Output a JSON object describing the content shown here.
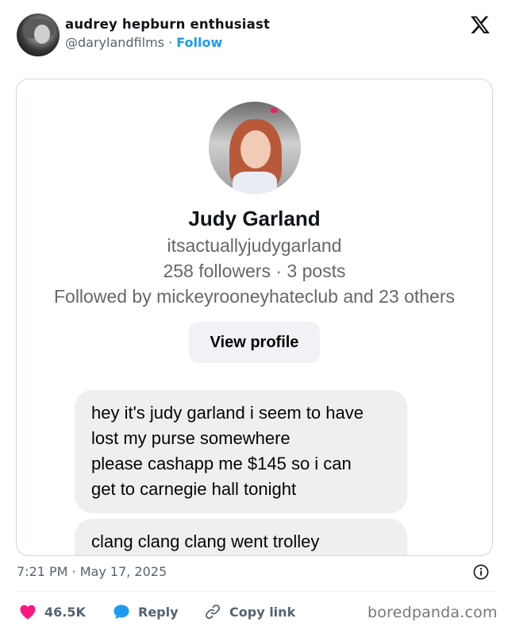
{
  "tweet": {
    "author_name": "audrey hepburn enthusiast",
    "author_handle": "@darylandfilms",
    "separator": " · ",
    "follow_label": "Follow",
    "timestamp": "7:21 PM · May 17, 2025"
  },
  "embedded_profile": {
    "display_name": "Judy Garland",
    "username": "itsactuallyjudygarland",
    "stats": "258 followers · 3 posts",
    "followed_by": "Followed by mickeyrooneyhateclub and 23 others",
    "view_profile_label": "View profile"
  },
  "messages": [
    {
      "lines": [
        "hey it's judy garland i seem to have",
        "lost my purse somewhere",
        "please cashapp me $145 so i can",
        "get to carnegie hall tonight"
      ]
    },
    {
      "lines": [
        "clang clang clang went trolley"
      ]
    }
  ],
  "actions": {
    "like_count": "46.5K",
    "reply_label": "Reply",
    "copy_link_label": "Copy link"
  },
  "watermark": "boredpanda.com",
  "icons": {
    "x_logo": "x-logo-icon",
    "like": "heart-icon",
    "reply": "speech-bubble-icon",
    "copy": "link-icon",
    "info": "info-icon"
  },
  "colors": {
    "accent": "#1d9bf0",
    "like": "#f91880",
    "muted": "#536471",
    "bubble": "#efefef"
  }
}
